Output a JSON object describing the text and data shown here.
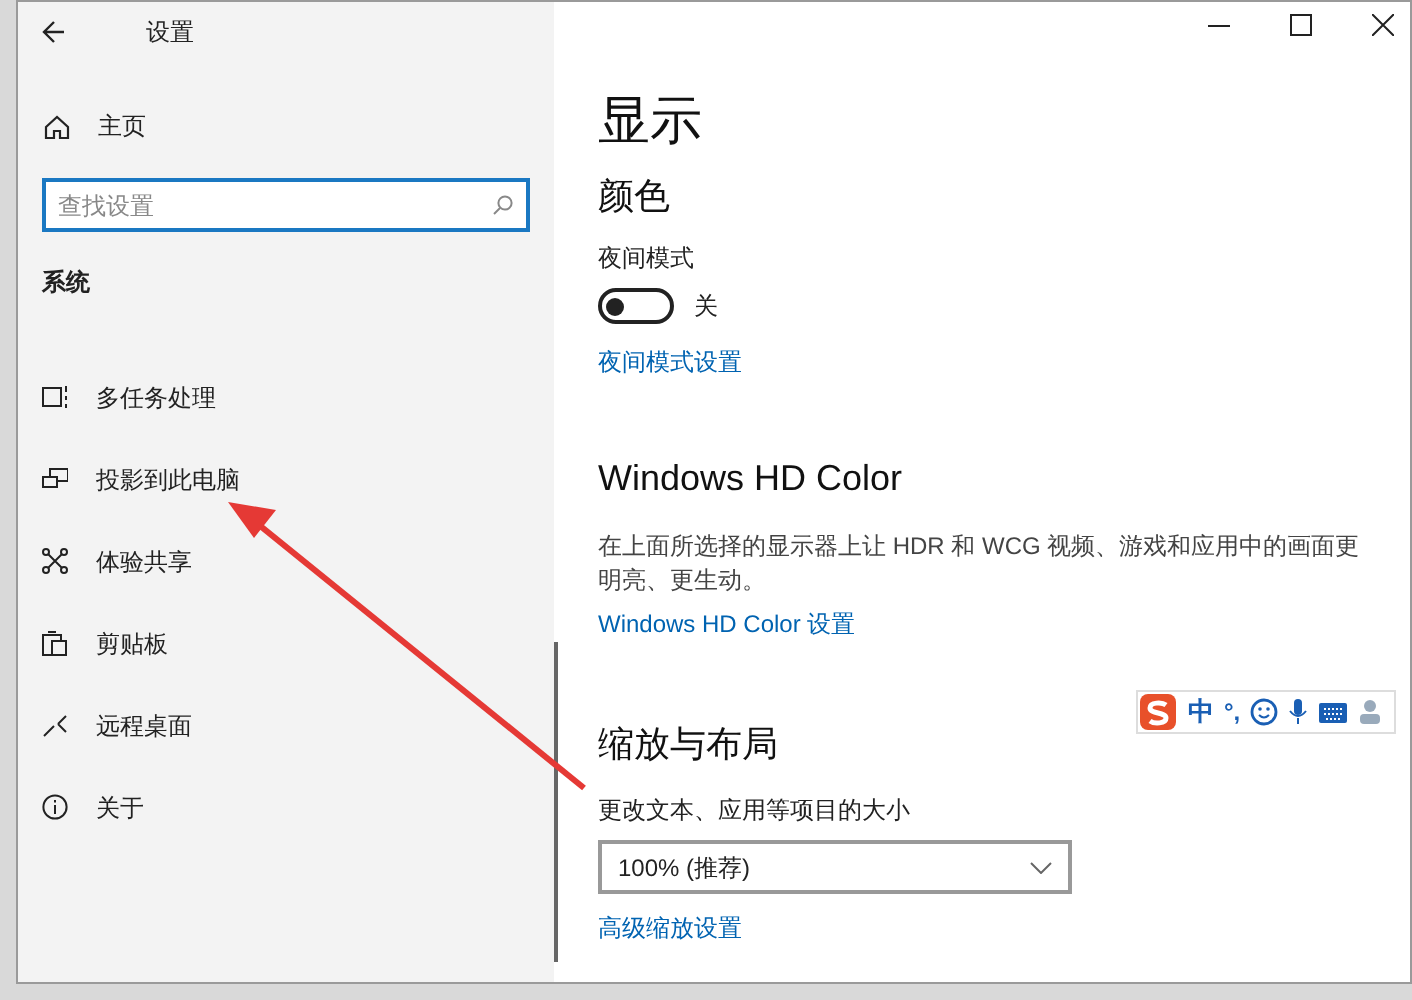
{
  "window": {
    "title": "设置"
  },
  "sidebar": {
    "home": "主页",
    "search": {
      "placeholder": "查找设置"
    },
    "section": "系统",
    "items": [
      {
        "label": "多任务处理"
      },
      {
        "label": "投影到此电脑"
      },
      {
        "label": "体验共享"
      },
      {
        "label": "剪贴板"
      },
      {
        "label": "远程桌面"
      },
      {
        "label": "关于"
      }
    ]
  },
  "main": {
    "title": "显示",
    "color": {
      "heading": "颜色",
      "night_mode": {
        "label": "夜间模式",
        "on": false,
        "state_text": "关"
      },
      "link": "夜间模式设置"
    },
    "hd_color": {
      "heading": "Windows HD Color",
      "description": "在上面所选择的显示器上让 HDR 和 WCG 视频、游戏和应用中的画面更明亮、更生动。",
      "link": "Windows HD Color 设置"
    },
    "scale": {
      "heading": "缩放与布局",
      "label": "更改文本、应用等项目的大小",
      "dropdown": "100% (推荐)",
      "link": "高级缩放设置"
    }
  },
  "ime_toolbar": {
    "items": [
      "中",
      "°,"
    ]
  }
}
